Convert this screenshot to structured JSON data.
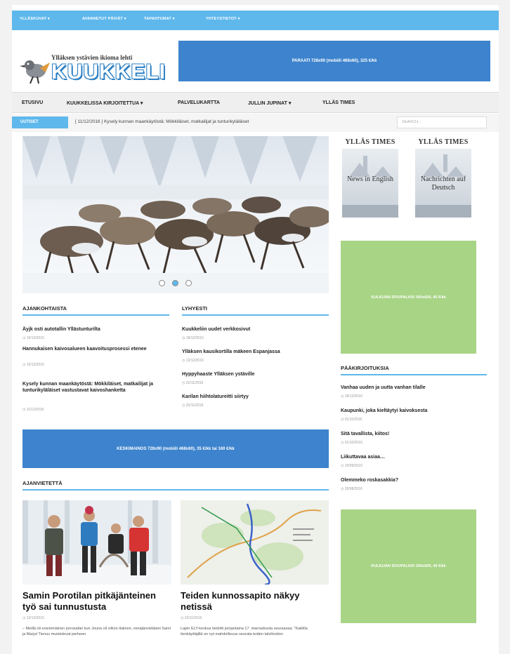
{
  "topbar": {
    "items": [
      "YLLÄSKUVAT ▾",
      "AVANNETUT PÄIVÄT ▾",
      "TAPAHTUMAT ▾",
      "YHTEYSTIETOT ▾"
    ]
  },
  "logo": {
    "tagline": "Ylläksen ystävien ikioma lehti",
    "brand": "KUUKKELI"
  },
  "ads": {
    "top": "PARAATI 728x90 (mobiili 468x60), 325 €/kk",
    "middle": "KESKIMAINOS 728x90 (mobiili 468x60), 35 €/kk tai 160 €/kk",
    "side1": "KULKIJAN SIVUPALKKI 300x600, 45 €/kk",
    "side2": "KULKIJAN SIVUPALKKI 300x600, 45 €/kk"
  },
  "mainnav": {
    "items": [
      "ETUSIVU",
      "KUUKKELISSA KIRJOITETTUA ▾",
      "PALVELUKARTTA",
      "JULLIN JUPINAT ▾",
      "YLLÄS TIMES"
    ]
  },
  "ticker": {
    "label": "UUTISET",
    "text": "[ 11/12/2016 ] Kysely kunnan maankäytöstä: Mökkiläiset, matkailijat ja tunturikyläläiset",
    "search_placeholder": "SEARCH..."
  },
  "ajankohtaista": {
    "title": "AJANKOHTAISTA",
    "items": [
      {
        "title": "Äyjk osti autotallin Yllästunturilta",
        "date": "◷ 15/12/2016"
      },
      {
        "title": "Hannukaisen kaivosalueen kaavoitusprosessi etenee",
        "date": "◷ 15/12/2016"
      },
      {
        "title": "Kysely kunnan maankäytöstä: Mökkiläiset, matkailijat ja tunturikyläläiset vastustavat kaivoshanketta",
        "date": "◷ 11/12/2016"
      }
    ]
  },
  "lyhyesti": {
    "title": "LYHYESTI",
    "items": [
      {
        "title": "Kuukkeliin uudet verkkosivut",
        "date": "◷ 18/12/2016"
      },
      {
        "title": "Ylläksen kausikortilla mäkeen Espanjassa",
        "date": "◷ 13/12/2016"
      },
      {
        "title": "Hyppyhaaste Ylläksen ystäville",
        "date": "◷ 22/11/2016"
      },
      {
        "title": "Karilan hiihtolatureitti siirtyy",
        "date": "◷ 20/11/2016"
      }
    ]
  },
  "yllas_times": {
    "left": {
      "title": "YLLÄS TIMES",
      "caption": "News in English"
    },
    "right": {
      "title": "YLLÄS TIMES",
      "caption": "Nachrichten auf Deutsch"
    }
  },
  "paakirjoituksia": {
    "title": "PÄÄKIRJOITUKSIA",
    "items": [
      {
        "title": "Vanhaa uuden ja uutta vanhan tilalle",
        "date": "◷ 18/12/2016"
      },
      {
        "title": "Kaupunki, joka kieltäytyi kaivoksesta",
        "date": "◷ 01/11/2016"
      },
      {
        "title": "Sitä tavallista, kiitos!",
        "date": "◷ 01/10/2016"
      },
      {
        "title": "Liikuttavaa asiaa…",
        "date": "◷ 15/09/2016"
      },
      {
        "title": "Olemmeko roskasakkia?",
        "date": "◷ 20/08/2016"
      }
    ]
  },
  "ajanvietetta": {
    "title": "AJANVIETETTÄ",
    "items": [
      {
        "title": "Samin Porotilan pitkäjänteinen työ sai tunnustusta",
        "date": "◷ 13/12/2016",
        "excerpt": "– Meillä oli ensimmäinen porosafari kun Jouna oli viikon ikäinen, venäjänvieläiset Sami ja Marjut Tienuu muistelevat perheen"
      },
      {
        "title": "Teiden kunnossapito näkyy netissä",
        "date": "◷ 23/11/2016",
        "excerpt": "Lapin ELY-keskus tiedotti perjantaina 17. marraskuuta seuraavaa: \"Kaikilla tienkäyttäjillä on nyt mahdollisuus seurata teiden talvihoidon"
      }
    ]
  },
  "colors": {
    "accent": "#5fb8ec",
    "ad_blue": "#3d83cd",
    "ad_green": "#a8d486"
  }
}
